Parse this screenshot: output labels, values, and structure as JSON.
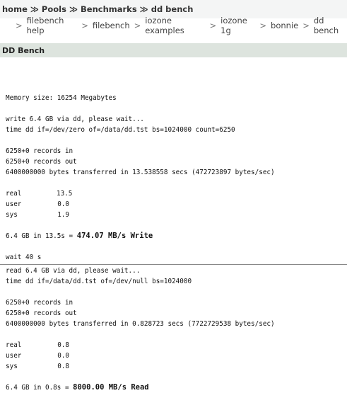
{
  "breadcrumb": {
    "items": [
      "home",
      "Pools",
      "Benchmarks",
      "dd bench"
    ],
    "separator": "≫"
  },
  "subnav": {
    "arrow": ">",
    "items": [
      "filebench help",
      "filebench",
      "iozone examples",
      "iozone 1g",
      "bonnie",
      "dd bench"
    ],
    "separator": ">"
  },
  "section": {
    "title": "DD Bench"
  },
  "output": {
    "memory": "Memory size: 16254 Megabytes",
    "write": {
      "msg": "write 6.4 GB via dd, please wait...",
      "cmd": "time dd if=/dev/zero of=/data/dd.tst bs=1024000 count=6250",
      "records_in": "6250+0 records in",
      "records_out": "6250+0 records out",
      "transfer": "6400000000 bytes transferred in 13.538558 secs (472723897 bytes/sec)",
      "real_label": "real",
      "real_value": "13.5",
      "user_label": "user",
      "user_value": "0.0",
      "sys_label": "sys",
      "sys_value": "1.9",
      "result_prefix": "6.4 GB in 13.5s = ",
      "result_value": "474.07 MB/s Write"
    },
    "wait": "wait 40 s",
    "read": {
      "msg": "read 6.4 GB via dd, please wait...",
      "cmd": "time dd if=/data/dd.tst of=/dev/null bs=1024000",
      "records_in": "6250+0 records in",
      "records_out": "6250+0 records out",
      "transfer": "6400000000 bytes transferred in 0.828723 secs (7722729538 bytes/sec)",
      "real_label": "real",
      "real_value": "0.8",
      "user_label": "user",
      "user_value": "0.0",
      "sys_label": "sys",
      "sys_value": "0.8",
      "result_prefix": "6.4 GB in 0.8s = ",
      "result_value": "8000.00 MB/s Read"
    }
  }
}
